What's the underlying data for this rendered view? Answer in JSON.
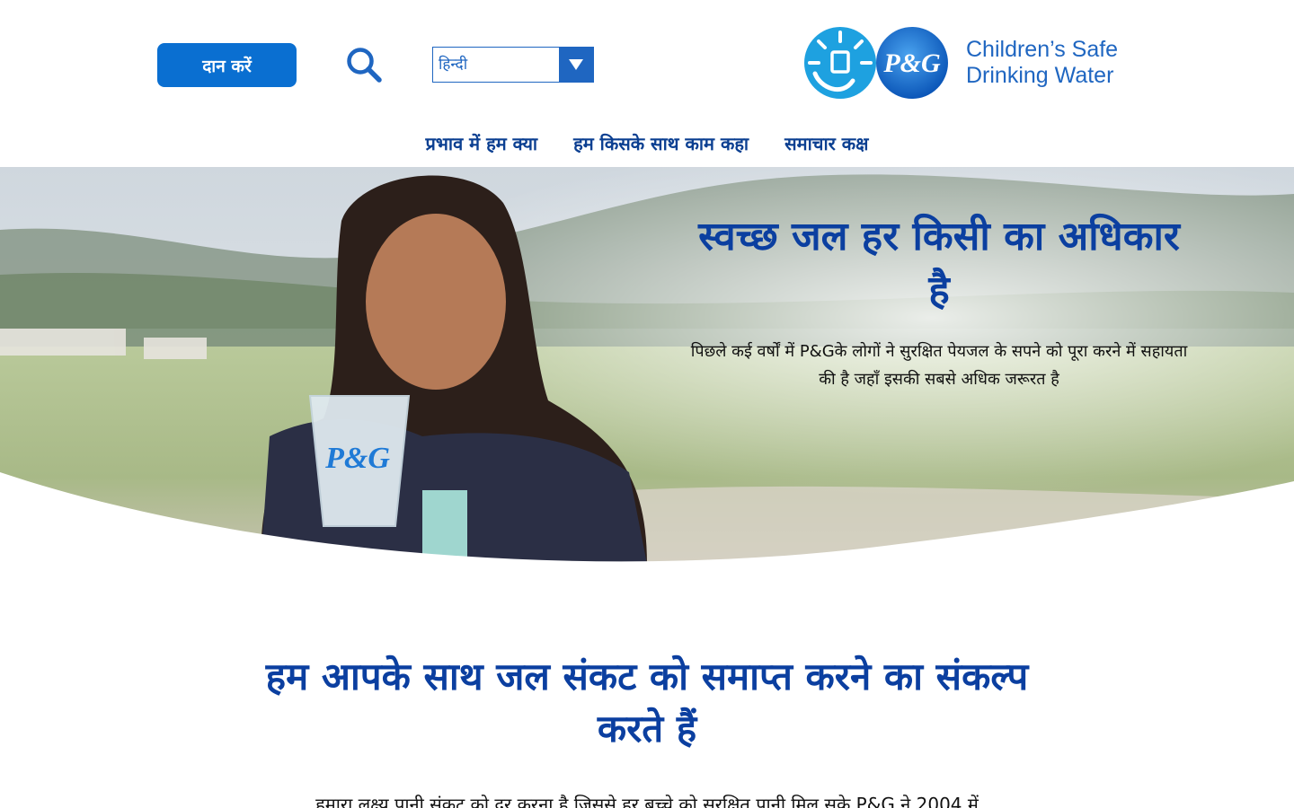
{
  "header": {
    "donate_label": "दान करें",
    "language_selected": "हिन्दी",
    "logo_text_line1": "Children’s Safe",
    "logo_text_line2": "Drinking Water",
    "logo_badge_text": "P&G"
  },
  "nav": {
    "items": [
      {
        "label": "प्रभाव में हम क्या"
      },
      {
        "label": "हम किसके साथ काम कहा"
      },
      {
        "label": "समाचार कक्ष"
      }
    ]
  },
  "hero": {
    "title": "स्वच्छ जल हर किसी का अधिकार है",
    "subtitle": "पिछले कई वर्षों में P&Gके लोगों ने सुरक्षित पेयजल के सपने को पूरा करने में सहायता की है जहाँ इसकी सबसे अधिक जरूरत है"
  },
  "section": {
    "title": "हम आपके साथ जल संकट को समाप्त करने का संकल्प करते हैं",
    "body": "हमारा लक्ष्य पानी संकट को दूर करना है जिससे हर बच्चे को सुरक्षित पानी मिल सके P&G ने 2004 में"
  },
  "colors": {
    "brand_blue": "#0a6fd1",
    "title_blue": "#0b3fa0",
    "nav_blue": "#0b3f91"
  },
  "icons": {
    "search": "search-icon",
    "dropdown": "chevron-down-icon",
    "logo_mark": "water-drop-logo-icon"
  }
}
